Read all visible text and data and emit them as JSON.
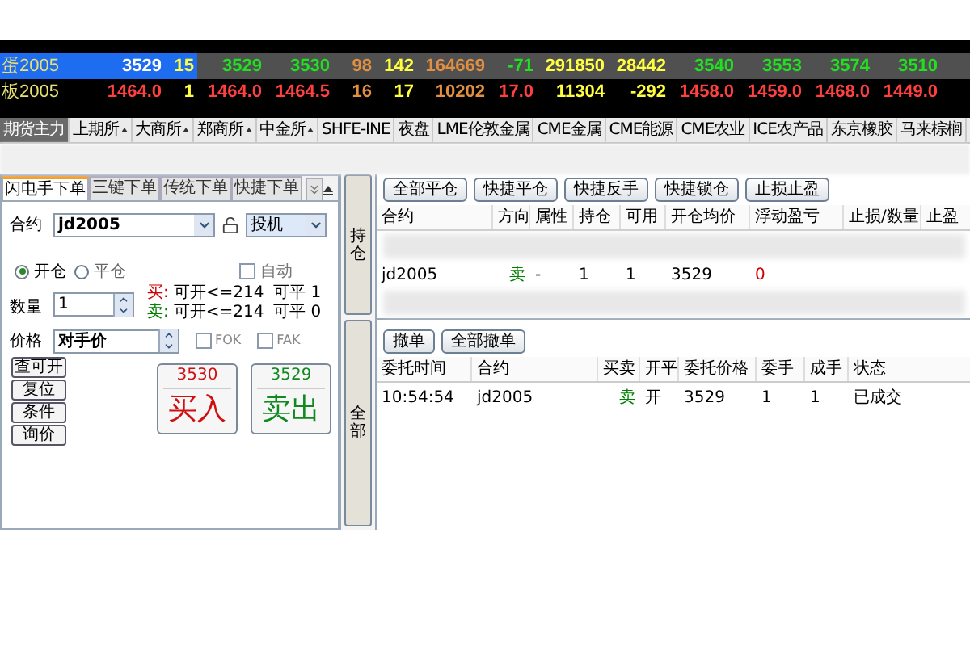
{
  "quotes": [
    {
      "name": "蛋2005",
      "selected": true,
      "cells": [
        {
          "text": "3529",
          "color": "#ffffff"
        },
        {
          "text": "15",
          "color": "#ffff40"
        },
        {
          "text": "3529",
          "color": "#20e020"
        },
        {
          "text": "3530",
          "color": "#20e020"
        },
        {
          "text": "98",
          "color": "#e09040"
        },
        {
          "text": "142",
          "color": "#ffff40"
        },
        {
          "text": "164669",
          "color": "#e09040"
        },
        {
          "text": "-71",
          "color": "#20e020"
        },
        {
          "text": "291850",
          "color": "#ffff40"
        },
        {
          "text": "28442",
          "color": "#ffff40"
        },
        {
          "text": "3540",
          "color": "#20e020"
        },
        {
          "text": "3553",
          "color": "#20e020"
        },
        {
          "text": "3574",
          "color": "#20e020"
        },
        {
          "text": "3510",
          "color": "#20e020"
        }
      ]
    },
    {
      "name": "板2005",
      "selected": false,
      "cells": [
        {
          "text": "1464.0",
          "color": "#ff4040"
        },
        {
          "text": "1",
          "color": "#ffff40"
        },
        {
          "text": "1464.0",
          "color": "#ff4040"
        },
        {
          "text": "1464.5",
          "color": "#ff4040"
        },
        {
          "text": "16",
          "color": "#e09040"
        },
        {
          "text": "17",
          "color": "#ffff40"
        },
        {
          "text": "10202",
          "color": "#e09040"
        },
        {
          "text": "17.0",
          "color": "#ff4040"
        },
        {
          "text": "11304",
          "color": "#ffff40"
        },
        {
          "text": "-292",
          "color": "#ffff40"
        },
        {
          "text": "1458.0",
          "color": "#ff4040"
        },
        {
          "text": "1459.0",
          "color": "#ff4040"
        },
        {
          "text": "1468.0",
          "color": "#ff4040"
        },
        {
          "text": "1449.0",
          "color": "#ff4040"
        }
      ]
    }
  ],
  "exchange_tabs": [
    {
      "label": "期货主力",
      "selected": true,
      "has_menu": false
    },
    {
      "label": "上期所",
      "selected": false,
      "has_menu": true
    },
    {
      "label": "大商所",
      "selected": false,
      "has_menu": true
    },
    {
      "label": "郑商所",
      "selected": false,
      "has_menu": true
    },
    {
      "label": "中金所",
      "selected": false,
      "has_menu": true
    },
    {
      "label": "SHFE-INE",
      "selected": false,
      "has_menu": false
    },
    {
      "label": "夜盘",
      "selected": false,
      "has_menu": false
    },
    {
      "label": "LME伦敦金属",
      "selected": false,
      "has_menu": false
    },
    {
      "label": "CME金属",
      "selected": false,
      "has_menu": false
    },
    {
      "label": "CME能源",
      "selected": false,
      "has_menu": false
    },
    {
      "label": "CME农业",
      "selected": false,
      "has_menu": false
    },
    {
      "label": "ICE农产品",
      "selected": false,
      "has_menu": false
    },
    {
      "label": "东京橡胶",
      "selected": false,
      "has_menu": false
    },
    {
      "label": "马来棕榈",
      "selected": false,
      "has_menu": false
    }
  ],
  "order_panel": {
    "tabs": [
      {
        "label": "闪电手下单",
        "selected": true
      },
      {
        "label": "三键下单",
        "selected": false
      },
      {
        "label": "传统下单",
        "selected": false
      },
      {
        "label": "快捷下单",
        "selected": false
      }
    ],
    "contract": {
      "label": "合约",
      "value": "jd2005"
    },
    "hedge_type": {
      "value": "投机"
    },
    "offset_options": [
      {
        "label": "开仓",
        "selected": true
      },
      {
        "label": "平仓",
        "selected": false
      }
    ],
    "auto": {
      "label": "自动",
      "checked": false
    },
    "quantity": {
      "label": "数量",
      "value": "1"
    },
    "availability": [
      {
        "side": "买:",
        "open": "可开<=214",
        "close_label": "可平",
        "close": "1",
        "color": "#cc0000"
      },
      {
        "side": "卖:",
        "open": "可开<=214",
        "close_label": "可平",
        "close": "0",
        "color": "#008000"
      }
    ],
    "price": {
      "label": "价格",
      "value": "对手价"
    },
    "price_flags": [
      {
        "label": "FOK",
        "checked": false
      },
      {
        "label": "FAK",
        "checked": false
      }
    ],
    "side_buttons": [
      "查可开",
      "复位",
      "条件",
      "询价"
    ],
    "trade_buttons": [
      {
        "kind": "buy",
        "price": "3530",
        "label": "买入"
      },
      {
        "kind": "sell",
        "price": "3529",
        "label": "卖出"
      }
    ]
  },
  "side_tabs": [
    "持仓",
    "全部"
  ],
  "positions": {
    "buttons": [
      "全部平仓",
      "快捷平仓",
      "快捷反手",
      "快捷锁仓",
      "止损止盈"
    ],
    "columns": [
      "合约",
      "方向",
      "属性",
      "持仓",
      "可用",
      "开仓均价",
      "浮动盈亏",
      "止损/数量",
      "止盈"
    ],
    "rows": [
      {
        "kind": "blurred"
      },
      {
        "kind": "data",
        "cells": [
          {
            "text": "jd2005"
          },
          {
            "text": "卖",
            "color": "#008000"
          },
          {
            "text": "-"
          },
          {
            "text": "1"
          },
          {
            "text": "1"
          },
          {
            "text": "3529"
          },
          {
            "text": "0",
            "color": "#cc0000"
          }
        ]
      },
      {
        "kind": "blurred"
      }
    ]
  },
  "orders": {
    "buttons": [
      "撤单",
      "全部撤单"
    ],
    "columns": [
      "委托时间",
      "合约",
      "买卖",
      "开平",
      "委托价格",
      "委手",
      "成手",
      "状态"
    ],
    "rows": [
      {
        "cells": [
          {
            "text": "10:54:54"
          },
          {
            "text": "jd2005"
          },
          {
            "text": "卖",
            "color": "#008000"
          },
          {
            "text": "开"
          },
          {
            "text": "3529"
          },
          {
            "text": "1"
          },
          {
            "text": "1"
          },
          {
            "text": "已成交"
          }
        ]
      }
    ]
  }
}
